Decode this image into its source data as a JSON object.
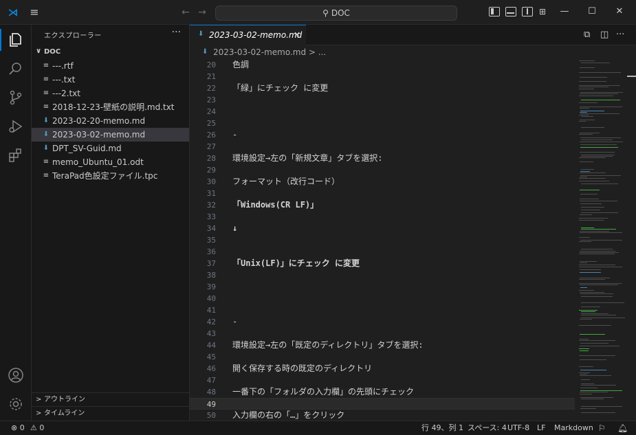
{
  "titlebar": {
    "search": "DOC",
    "back": "←",
    "forward": "→"
  },
  "explorer": {
    "title": "エクスプローラー",
    "more": "···",
    "folder": "DOC",
    "files": [
      {
        "name": "---.rtf",
        "kind": "text",
        "icon": "≡"
      },
      {
        "name": "---.txt",
        "kind": "text",
        "icon": "≡"
      },
      {
        "name": "---2.txt",
        "kind": "text",
        "icon": "≡"
      },
      {
        "name": "2018-12-23-壁紙の説明.md.txt",
        "kind": "text",
        "icon": "≡"
      },
      {
        "name": "2023-02-20-memo.md",
        "kind": "markdown",
        "icon": "⬇"
      },
      {
        "name": "2023-03-02-memo.md",
        "kind": "markdown",
        "icon": "⬇",
        "selected": true
      },
      {
        "name": "DPT_SV-Guid.md",
        "kind": "markdown",
        "icon": "⬇"
      },
      {
        "name": "memo_Ubuntu_01.odt",
        "kind": "text",
        "icon": "≡"
      },
      {
        "name": "TeraPad色設定ファイル.tpc",
        "kind": "text",
        "icon": "≡"
      }
    ],
    "outline": "アウトライン",
    "timeline": "タイムライン"
  },
  "editor": {
    "tab_label": "2023-03-02-memo.md",
    "tab_close": "×",
    "breadcrumb": "2023-03-02-memo.md > ...",
    "current_line": 49,
    "lines": [
      {
        "n": "20",
        "text": "色調"
      },
      {
        "n": "21",
        "text": ""
      },
      {
        "n": "22",
        "text": "「緑」にチェック に変更"
      },
      {
        "n": "23",
        "text": ""
      },
      {
        "n": "24",
        "text": ""
      },
      {
        "n": "25",
        "text": ""
      },
      {
        "n": "26",
        "text": "-"
      },
      {
        "n": "27",
        "text": ""
      },
      {
        "n": "28",
        "text": "環境設定→左の「新規文章」タブを選択:"
      },
      {
        "n": "29",
        "text": ""
      },
      {
        "n": "30",
        "text": "フォーマット（改行コード）"
      },
      {
        "n": "31",
        "text": ""
      },
      {
        "n": "32",
        "text": "「Windows(CR LF)」",
        "bold": true
      },
      {
        "n": "33",
        "text": ""
      },
      {
        "n": "34",
        "text": "↓",
        "bold": true
      },
      {
        "n": "35",
        "text": ""
      },
      {
        "n": "36",
        "text": ""
      },
      {
        "n": "37",
        "text": "「Unix(LF)」にチェック に変更",
        "bold": true
      },
      {
        "n": "38",
        "text": ""
      },
      {
        "n": "39",
        "text": ""
      },
      {
        "n": "40",
        "text": ""
      },
      {
        "n": "41",
        "text": ""
      },
      {
        "n": "42",
        "text": "-"
      },
      {
        "n": "43",
        "text": ""
      },
      {
        "n": "44",
        "text": "環境設定→左の「既定のディレクトリ」タブを選択:"
      },
      {
        "n": "45",
        "text": ""
      },
      {
        "n": "46",
        "text": "開く保存する時の既定のディレクトリ"
      },
      {
        "n": "47",
        "text": ""
      },
      {
        "n": "48",
        "text": "一番下の「フォルダの入力欄」の先頭にチェック"
      },
      {
        "n": "49",
        "text": ""
      },
      {
        "n": "50",
        "text": "入力欄の右の「…」をクリック"
      }
    ]
  },
  "statusbar": {
    "errors": "⊗ 0",
    "warnings": "⚠ 0",
    "position": "行 49、列 1",
    "spaces": "スペース: 4",
    "encoding": "UTF-8",
    "eol": "LF",
    "language": "Markdown"
  },
  "colors": {
    "accent": "#0078d4",
    "markdown_icon": "#519aba",
    "vscode_logo": "#0e82d6"
  }
}
